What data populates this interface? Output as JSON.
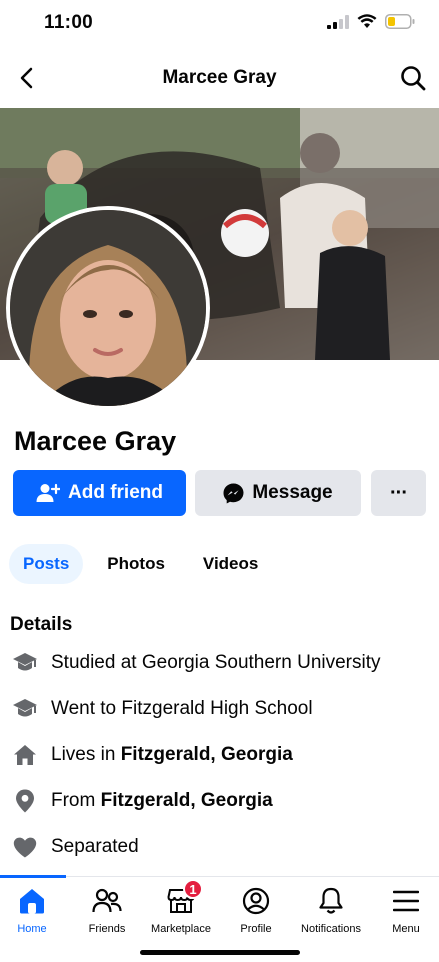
{
  "status_bar": {
    "time": "11:00"
  },
  "nav": {
    "title": "Marcee Gray"
  },
  "profile": {
    "name": "Marcee Gray"
  },
  "actions": {
    "add_friend": "Add friend",
    "message": "Message",
    "more": "···"
  },
  "tabs": [
    {
      "label": "Posts",
      "active": true
    },
    {
      "label": "Photos",
      "active": false
    },
    {
      "label": "Videos",
      "active": false
    }
  ],
  "details": {
    "title": "Details",
    "items": [
      {
        "icon": "graduation-cap-icon",
        "prefix": "Studied at Georgia Southern University",
        "bold": ""
      },
      {
        "icon": "graduation-cap-icon",
        "prefix": "Went to Fitzgerald High School",
        "bold": ""
      },
      {
        "icon": "house-icon",
        "prefix": "Lives in ",
        "bold": "Fitzgerald, Georgia"
      },
      {
        "icon": "location-pin-icon",
        "prefix": "From ",
        "bold": "Fitzgerald, Georgia"
      },
      {
        "icon": "heart-icon",
        "prefix": "Separated",
        "bold": ""
      }
    ]
  },
  "bottom_nav": [
    {
      "label": "Home",
      "icon": "home-icon",
      "active": true
    },
    {
      "label": "Friends",
      "icon": "friends-icon",
      "active": false
    },
    {
      "label": "Marketplace",
      "icon": "marketplace-icon",
      "active": false,
      "badge": "1"
    },
    {
      "label": "Profile",
      "icon": "profile-icon",
      "active": false
    },
    {
      "label": "Notifications",
      "icon": "bell-icon",
      "active": false
    },
    {
      "label": "Menu",
      "icon": "menu-icon",
      "active": false
    }
  ],
  "colors": {
    "accent": "#0866ff",
    "button_secondary": "#e4e6eb",
    "badge": "#e41e3f",
    "icon_gray": "#65676b"
  }
}
